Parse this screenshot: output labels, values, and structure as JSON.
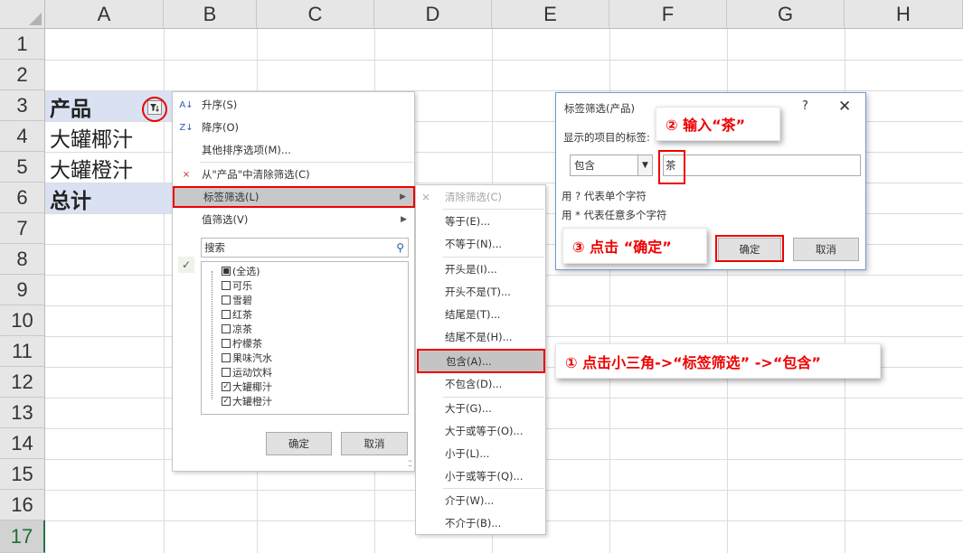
{
  "columns": [
    "A",
    "B",
    "C",
    "D",
    "E",
    "F",
    "G",
    "H"
  ],
  "rows": [
    "1",
    "2",
    "3",
    "4",
    "5",
    "6",
    "7",
    "8",
    "9",
    "10",
    "11",
    "12",
    "13",
    "14",
    "15",
    "16",
    "17"
  ],
  "cells": {
    "a3": "产品",
    "b3_partial": "x",
    "a4": "大罐椰汁",
    "a5": "大罐橙汁",
    "a6": "总计"
  },
  "filter_menu": {
    "sort_asc": "升序(S)",
    "sort_desc": "降序(O)",
    "more_sort": "其他排序选项(M)...",
    "clear_filter": "从\"产品\"中清除筛选(C)",
    "label_filter": "标签筛选(L)",
    "value_filter": "值筛选(V)",
    "search_placeholder": "搜索",
    "items": [
      {
        "label": "(全选)",
        "state": "partial"
      },
      {
        "label": "可乐",
        "state": "unchecked"
      },
      {
        "label": "雪碧",
        "state": "unchecked"
      },
      {
        "label": "红茶",
        "state": "unchecked"
      },
      {
        "label": "凉茶",
        "state": "unchecked"
      },
      {
        "label": "柠檬茶",
        "state": "unchecked"
      },
      {
        "label": "果味汽水",
        "state": "unchecked"
      },
      {
        "label": "运动饮料",
        "state": "unchecked"
      },
      {
        "label": "大罐椰汁",
        "state": "checked"
      },
      {
        "label": "大罐橙汁",
        "state": "checked"
      }
    ],
    "ok": "确定",
    "cancel": "取消"
  },
  "label_submenu": {
    "clear": "清除筛选(C)",
    "eq": "等于(E)...",
    "neq": "不等于(N)...",
    "begins": "开头是(I)...",
    "not_begins": "开头不是(T)...",
    "ends": "结尾是(T)...",
    "not_ends": "结尾不是(H)...",
    "contains": "包含(A)...",
    "not_contains": "不包含(D)...",
    "gt": "大于(G)...",
    "gte": "大于或等于(O)...",
    "lt": "小于(L)...",
    "lte": "小于或等于(Q)...",
    "between": "介于(W)...",
    "not_between": "不介于(B)..."
  },
  "dialog": {
    "title": "标签筛选(产品)",
    "help": "?",
    "close": "✕",
    "label": "显示的项目的标签:",
    "operator": "包含",
    "value": "茶",
    "hint1": "用 ? 代表单个字符",
    "hint2": "用 * 代表任意多个字符",
    "ok": "确定",
    "cancel": "取消"
  },
  "callouts": {
    "step1": "① 点击小三角->“标签筛选” ->“包含”",
    "step2": "② 输入“茶”",
    "step3": "③ 点击 “确定”"
  },
  "colors": {
    "header_bg": "#e6e6e6",
    "highlight_cell": "#d9e1f2",
    "annotation_red": "#ee0000",
    "dialog_border": "#6c9bd2"
  }
}
